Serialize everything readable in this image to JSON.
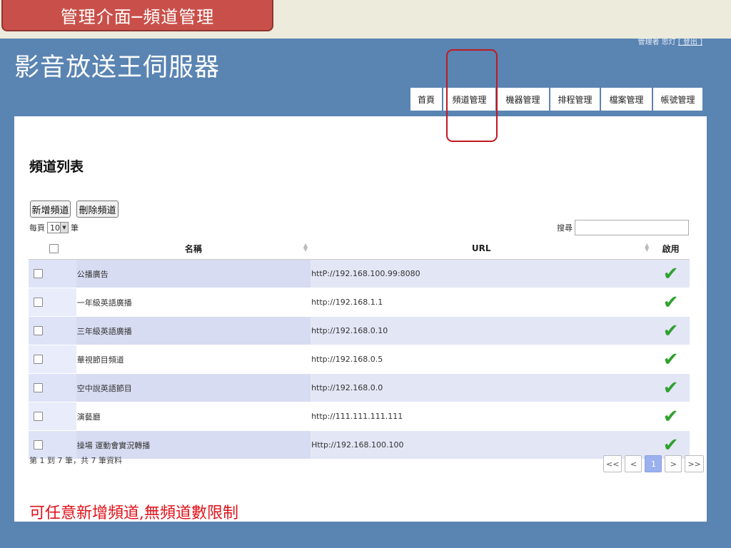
{
  "slide": {
    "title": "管理介面─頻道管理"
  },
  "app": {
    "title": "影音放送王伺服器",
    "user_label": "管理者 忠灯",
    "logout_label": "[ 登出 ]"
  },
  "nav": {
    "tabs": [
      "首頁",
      "頻道管理",
      "機器管理",
      "排程管理",
      "檔案管理",
      "帳號管理"
    ]
  },
  "page": {
    "title": "頻道列表",
    "add_button": "新增頻道",
    "delete_button": "刪除頻道",
    "per_page_prefix": "每頁",
    "per_page_value": "10",
    "per_page_suffix": "筆",
    "search_label": "搜尋",
    "search_value": ""
  },
  "table": {
    "headers": {
      "name": "名稱",
      "url": "URL",
      "enabled": "啟用"
    },
    "rows": [
      {
        "name": "公播廣告",
        "url": "httP://192.168.100.99:8080",
        "enabled": "✔"
      },
      {
        "name": "一年級英語廣播",
        "url": "http://192.168.1.1",
        "enabled": "✔"
      },
      {
        "name": "三年級英語廣播",
        "url": "http://192.168.0.10",
        "enabled": "✔"
      },
      {
        "name": "華視節目頻道",
        "url": "http://192.168.0.5",
        "enabled": "✔"
      },
      {
        "name": "空中說英語節目",
        "url": "http://192.168.0.0",
        "enabled": "✔"
      },
      {
        "name": "演藝廳",
        "url": "http://111.111.111.111",
        "enabled": "✔"
      },
      {
        "name": "操場 運動會實況轉播",
        "url": "Http://192.168.100.100",
        "enabled": "✔"
      }
    ],
    "footer": "第 1 到 7 筆，共 7 筆資料"
  },
  "pager": {
    "first": "<<",
    "prev": "<",
    "current": "1",
    "next": ">",
    "last": ">>"
  },
  "note": "可任意新增頻道,無頻道數限制",
  "colors": {
    "background": "#5a84b2",
    "accent_red": "#c9504a",
    "check_green": "#2ea12e"
  }
}
